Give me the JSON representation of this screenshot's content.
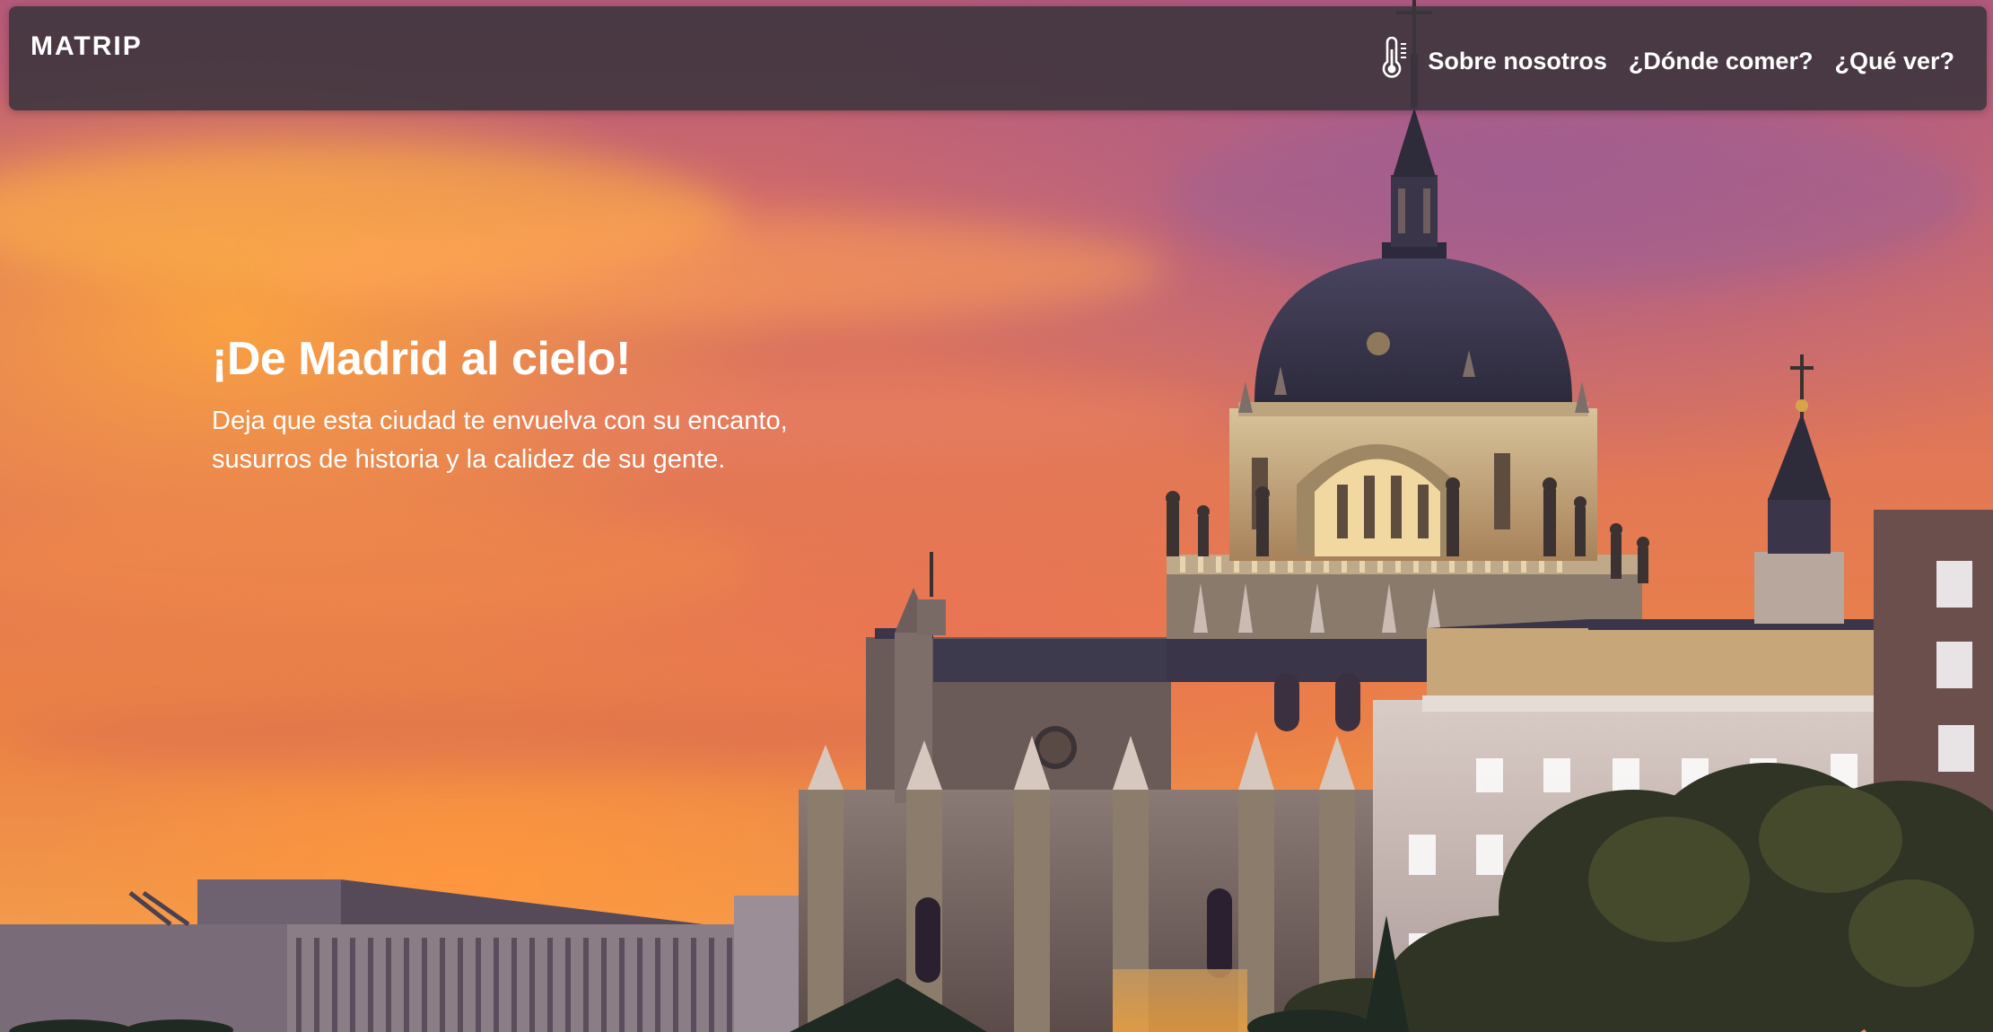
{
  "brand": {
    "logo_text": "MATRIP"
  },
  "nav": {
    "weather_icon": "thermometer-icon",
    "links": [
      {
        "label": "Sobre nosotros"
      },
      {
        "label": "¿Dónde comer?"
      },
      {
        "label": "¿Qué ver?"
      }
    ]
  },
  "hero": {
    "title": "¡De Madrid al cielo!",
    "subtitle_line1": "Deja que esta ciudad te envuelva con su encanto,",
    "subtitle_line2": "susurros de historia y la calidez de su gente."
  },
  "colors": {
    "navbar_bg": "#3a343c",
    "text": "#ffffff",
    "sky_top": "#b4597a",
    "sky_bottom": "#f39a4a"
  }
}
